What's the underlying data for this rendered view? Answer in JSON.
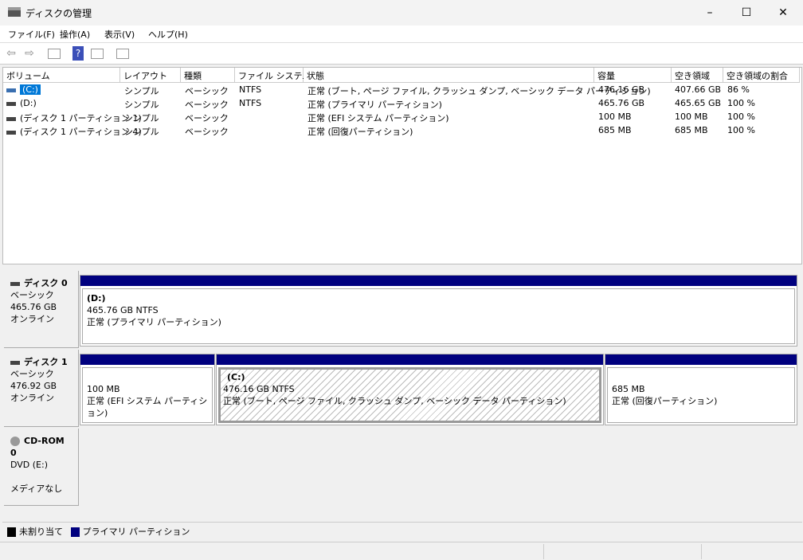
{
  "window": {
    "title": "ディスクの管理",
    "minimize": "–",
    "maximize": "☐",
    "close": "✕"
  },
  "menu": [
    "ファイル(F)",
    "操作(A)",
    "表示(V)",
    "ヘルプ(H)"
  ],
  "toolbar": {
    "back": "⇦",
    "forward": "⇨",
    "help": "?"
  },
  "columns": [
    "ボリューム",
    "レイアウト",
    "種類",
    "ファイル システム",
    "状態",
    "容量",
    "空き領域",
    "空き領域の割合"
  ],
  "volumes": [
    {
      "name": "(C:)",
      "layout": "シンプル",
      "type": "ベーシック",
      "fs": "NTFS",
      "status": "正常 (ブート, ページ ファイル, クラッシュ ダンプ, ベーシック データ パーティション)",
      "capacity": "476.16 GB",
      "free": "407.66 GB",
      "pct": "86 %"
    },
    {
      "name": "(D:)",
      "layout": "シンプル",
      "type": "ベーシック",
      "fs": "NTFS",
      "status": "正常 (プライマリ パーティション)",
      "capacity": "465.76 GB",
      "free": "465.65 GB",
      "pct": "100 %"
    },
    {
      "name": "(ディスク 1 パーティション 1)",
      "layout": "シンプル",
      "type": "ベーシック",
      "fs": "",
      "status": "正常 (EFI システム パーティション)",
      "capacity": "100 MB",
      "free": "100 MB",
      "pct": "100 %"
    },
    {
      "name": "(ディスク 1 パーティション 4)",
      "layout": "シンプル",
      "type": "ベーシック",
      "fs": "",
      "status": "正常 (回復パーティション)",
      "capacity": "685 MB",
      "free": "685 MB",
      "pct": "100 %"
    }
  ],
  "disks": [
    {
      "name": "ディスク 0",
      "type": "ベーシック",
      "size": "465.76 GB",
      "state": "オンライン",
      "partitions": [
        {
          "label": "(D:)",
          "size": "465.76 GB NTFS",
          "status": "正常 (プライマリ パーティション)"
        }
      ]
    },
    {
      "name": "ディスク 1",
      "type": "ベーシック",
      "size": "476.92 GB",
      "state": "オンライン",
      "partitions": [
        {
          "label": "",
          "size": "100 MB",
          "status": "正常 (EFI システム パーティション)"
        },
        {
          "label": "(C:)",
          "size": "476.16 GB NTFS",
          "status": "正常 (ブート, ページ ファイル, クラッシュ ダンプ, ベーシック データ パーティション)"
        },
        {
          "label": "",
          "size": "685 MB",
          "status": "正常 (回復パーティション)"
        }
      ]
    },
    {
      "name": "CD-ROM 0",
      "type": "DVD (E:)",
      "media": "メディアなし"
    }
  ],
  "legend": [
    {
      "label": "未割り当て",
      "color": "#000000"
    },
    {
      "label": "プライマリ パーティション",
      "color": "#00007f"
    }
  ]
}
